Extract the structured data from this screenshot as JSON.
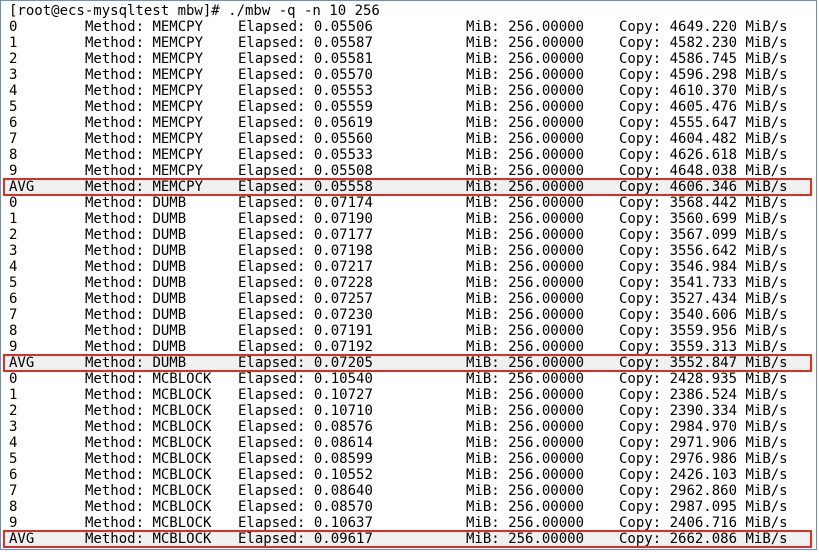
{
  "terminal": {
    "command_line": "[root@ecs-mysqltest mbw]# ./mbw -q -n 10 256",
    "rows": [
      {
        "idx": "0",
        "method": "MEMCPY",
        "elapsed": "0.05506",
        "mib": "256.00000",
        "copy": "4649.220"
      },
      {
        "idx": "1",
        "method": "MEMCPY",
        "elapsed": "0.05587",
        "mib": "256.00000",
        "copy": "4582.230"
      },
      {
        "idx": "2",
        "method": "MEMCPY",
        "elapsed": "0.05581",
        "mib": "256.00000",
        "copy": "4586.745"
      },
      {
        "idx": "3",
        "method": "MEMCPY",
        "elapsed": "0.05570",
        "mib": "256.00000",
        "copy": "4596.298"
      },
      {
        "idx": "4",
        "method": "MEMCPY",
        "elapsed": "0.05553",
        "mib": "256.00000",
        "copy": "4610.370"
      },
      {
        "idx": "5",
        "method": "MEMCPY",
        "elapsed": "0.05559",
        "mib": "256.00000",
        "copy": "4605.476"
      },
      {
        "idx": "6",
        "method": "MEMCPY",
        "elapsed": "0.05619",
        "mib": "256.00000",
        "copy": "4555.647"
      },
      {
        "idx": "7",
        "method": "MEMCPY",
        "elapsed": "0.05560",
        "mib": "256.00000",
        "copy": "4604.482"
      },
      {
        "idx": "8",
        "method": "MEMCPY",
        "elapsed": "0.05533",
        "mib": "256.00000",
        "copy": "4626.618"
      },
      {
        "idx": "9",
        "method": "MEMCPY",
        "elapsed": "0.05508",
        "mib": "256.00000",
        "copy": "4648.038"
      },
      {
        "idx": "AVG",
        "method": "MEMCPY",
        "elapsed": "0.05558",
        "mib": "256.00000",
        "copy": "4606.346",
        "avg": true
      },
      {
        "idx": "0",
        "method": "DUMB",
        "elapsed": "0.07174",
        "mib": "256.00000",
        "copy": "3568.442"
      },
      {
        "idx": "1",
        "method": "DUMB",
        "elapsed": "0.07190",
        "mib": "256.00000",
        "copy": "3560.699"
      },
      {
        "idx": "2",
        "method": "DUMB",
        "elapsed": "0.07177",
        "mib": "256.00000",
        "copy": "3567.099"
      },
      {
        "idx": "3",
        "method": "DUMB",
        "elapsed": "0.07198",
        "mib": "256.00000",
        "copy": "3556.642"
      },
      {
        "idx": "4",
        "method": "DUMB",
        "elapsed": "0.07217",
        "mib": "256.00000",
        "copy": "3546.984"
      },
      {
        "idx": "5",
        "method": "DUMB",
        "elapsed": "0.07228",
        "mib": "256.00000",
        "copy": "3541.733"
      },
      {
        "idx": "6",
        "method": "DUMB",
        "elapsed": "0.07257",
        "mib": "256.00000",
        "copy": "3527.434"
      },
      {
        "idx": "7",
        "method": "DUMB",
        "elapsed": "0.07230",
        "mib": "256.00000",
        "copy": "3540.606"
      },
      {
        "idx": "8",
        "method": "DUMB",
        "elapsed": "0.07191",
        "mib": "256.00000",
        "copy": "3559.956"
      },
      {
        "idx": "9",
        "method": "DUMB",
        "elapsed": "0.07192",
        "mib": "256.00000",
        "copy": "3559.313"
      },
      {
        "idx": "AVG",
        "method": "DUMB",
        "elapsed": "0.07205",
        "mib": "256.00000",
        "copy": "3552.847",
        "avg": true
      },
      {
        "idx": "0",
        "method": "MCBLOCK",
        "elapsed": "0.10540",
        "mib": "256.00000",
        "copy": "2428.935"
      },
      {
        "idx": "1",
        "method": "MCBLOCK",
        "elapsed": "0.10727",
        "mib": "256.00000",
        "copy": "2386.524"
      },
      {
        "idx": "2",
        "method": "MCBLOCK",
        "elapsed": "0.10710",
        "mib": "256.00000",
        "copy": "2390.334"
      },
      {
        "idx": "3",
        "method": "MCBLOCK",
        "elapsed": "0.08576",
        "mib": "256.00000",
        "copy": "2984.970"
      },
      {
        "idx": "4",
        "method": "MCBLOCK",
        "elapsed": "0.08614",
        "mib": "256.00000",
        "copy": "2971.906"
      },
      {
        "idx": "5",
        "method": "MCBLOCK",
        "elapsed": "0.08599",
        "mib": "256.00000",
        "copy": "2976.986"
      },
      {
        "idx": "6",
        "method": "MCBLOCK",
        "elapsed": "0.10552",
        "mib": "256.00000",
        "copy": "2426.103"
      },
      {
        "idx": "7",
        "method": "MCBLOCK",
        "elapsed": "0.08640",
        "mib": "256.00000",
        "copy": "2962.860"
      },
      {
        "idx": "8",
        "method": "MCBLOCK",
        "elapsed": "0.08570",
        "mib": "256.00000",
        "copy": "2987.095"
      },
      {
        "idx": "9",
        "method": "MCBLOCK",
        "elapsed": "0.10637",
        "mib": "256.00000",
        "copy": "2406.716"
      },
      {
        "idx": "AVG",
        "method": "MCBLOCK",
        "elapsed": "0.09617",
        "mib": "256.00000",
        "copy": "2662.086",
        "avg": true
      }
    ],
    "labels": {
      "method": "Method:",
      "elapsed": "Elapsed:",
      "mib": "MiB:",
      "copy": "Copy:",
      "unit": "MiB/s"
    },
    "highlight_color": "#d93025"
  }
}
